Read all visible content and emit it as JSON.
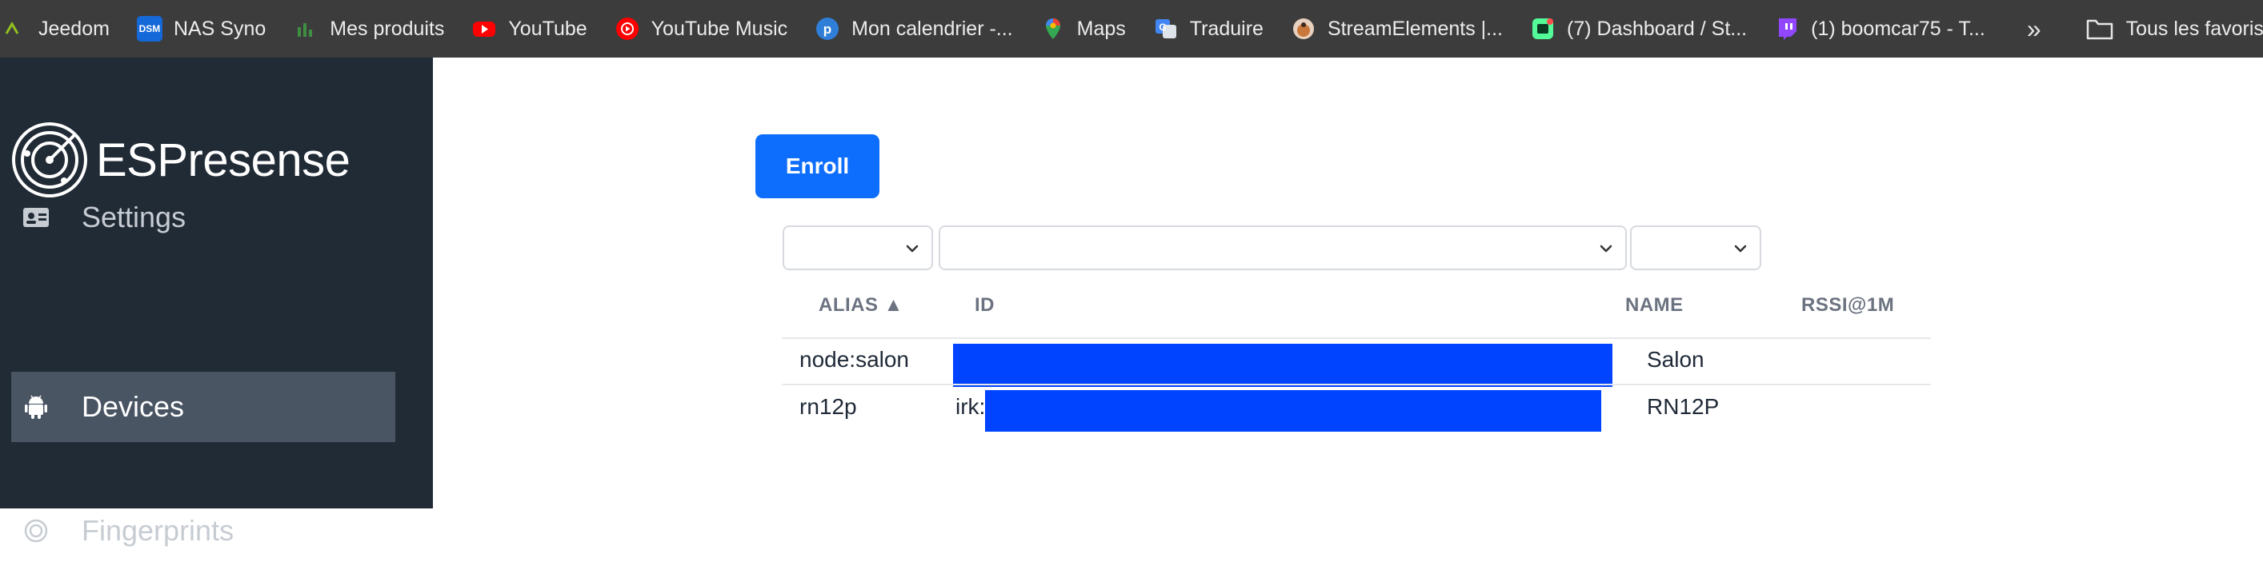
{
  "bookmarks": [
    {
      "label": "Jeedom",
      "icon": "jeedom-icon",
      "color": "#94c11f"
    },
    {
      "label": "NAS Syno",
      "icon": "dsm-icon",
      "color": "#1468d8"
    },
    {
      "label": "Mes produits",
      "icon": "products-icon",
      "color": "#3e8e41"
    },
    {
      "label": "YouTube",
      "icon": "youtube-icon",
      "color": "#ff0000"
    },
    {
      "label": "YouTube Music",
      "icon": "youtube-music-icon",
      "color": "#ff0000"
    },
    {
      "label": "Mon calendrier -...",
      "icon": "calendar-icon",
      "color": "#2f7fd8"
    },
    {
      "label": "Maps",
      "icon": "maps-icon",
      "color": "#34a853"
    },
    {
      "label": "Traduire",
      "icon": "translate-icon",
      "color": "#4285f4"
    },
    {
      "label": "StreamElements |...",
      "icon": "streamelements-icon",
      "color": "#c9773a"
    },
    {
      "label": "(7) Dashboard / St...",
      "icon": "dashboard-icon",
      "color": "#53fc98"
    },
    {
      "label": "(1) boomcar75 - T...",
      "icon": "twitch-icon",
      "color": "#9146ff"
    }
  ],
  "bookmarks_folder": "Tous les favoris",
  "brand": {
    "name": "ESPresense"
  },
  "nav": {
    "settings": "Settings",
    "devices": "Devices",
    "fingerprints": "Fingerprints"
  },
  "enroll_label": "Enroll",
  "table": {
    "headers": {
      "alias": "ALIAS ▲",
      "id": "ID",
      "name": "NAME",
      "rssi": "RSSI@1M"
    },
    "rows": [
      {
        "alias": "node:salon",
        "id": "",
        "name": "Salon",
        "rssi": ""
      },
      {
        "alias": "rn12p",
        "id": "irk:",
        "name": "RN12P",
        "rssi": ""
      }
    ]
  },
  "colors": {
    "accent": "#0d6efd",
    "sidebar": "#212b36",
    "sidebar_active": "#4a5563",
    "redaction": "#0044ff"
  }
}
